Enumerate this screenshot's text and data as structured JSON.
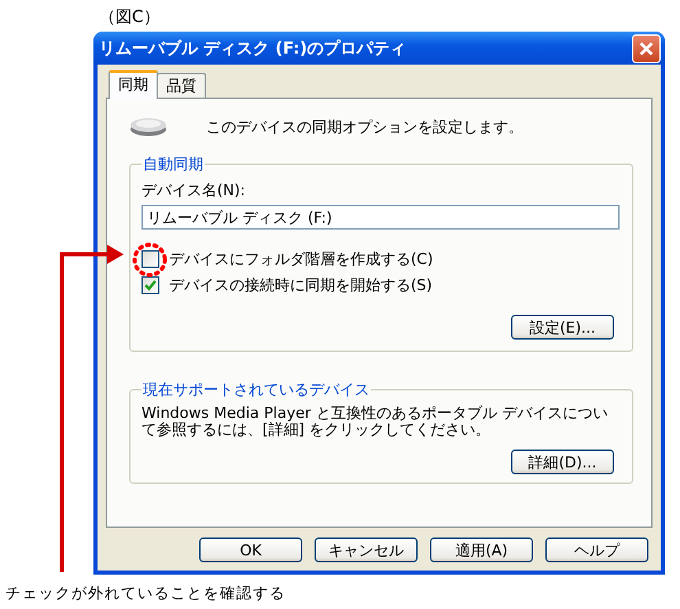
{
  "caption": "（図C）",
  "window": {
    "title": "リムーバブル ディスク (F:)のプロパティ"
  },
  "tabs": [
    {
      "label": "同期",
      "selected": true
    },
    {
      "label": "品質",
      "selected": false
    }
  ],
  "intro": "このデバイスの同期オプションを設定します。",
  "auto_sync": {
    "title": "自動同期",
    "device_name_label": "デバイス名(N):",
    "device_name": "リムーバブル ディスク (F:)",
    "checkboxes": [
      {
        "label": "デバイスにフォルダ階層を作成する(C)",
        "checked": false
      },
      {
        "label": "デバイスの接続時に同期を開始する(S)",
        "checked": true
      }
    ],
    "settings_button": "設定(E)..."
  },
  "supported": {
    "title": "現在サポートされているデバイス",
    "text": "Windows Media Player と互換性のあるポータブル デバイスについて参照するには、[詳細] をクリックしてください。",
    "button": "詳細(D)..."
  },
  "buttons": [
    "OK",
    "キャンセル",
    "適用(A)",
    "ヘルプ"
  ],
  "annotation": "チェックが外れていることを確認する"
}
